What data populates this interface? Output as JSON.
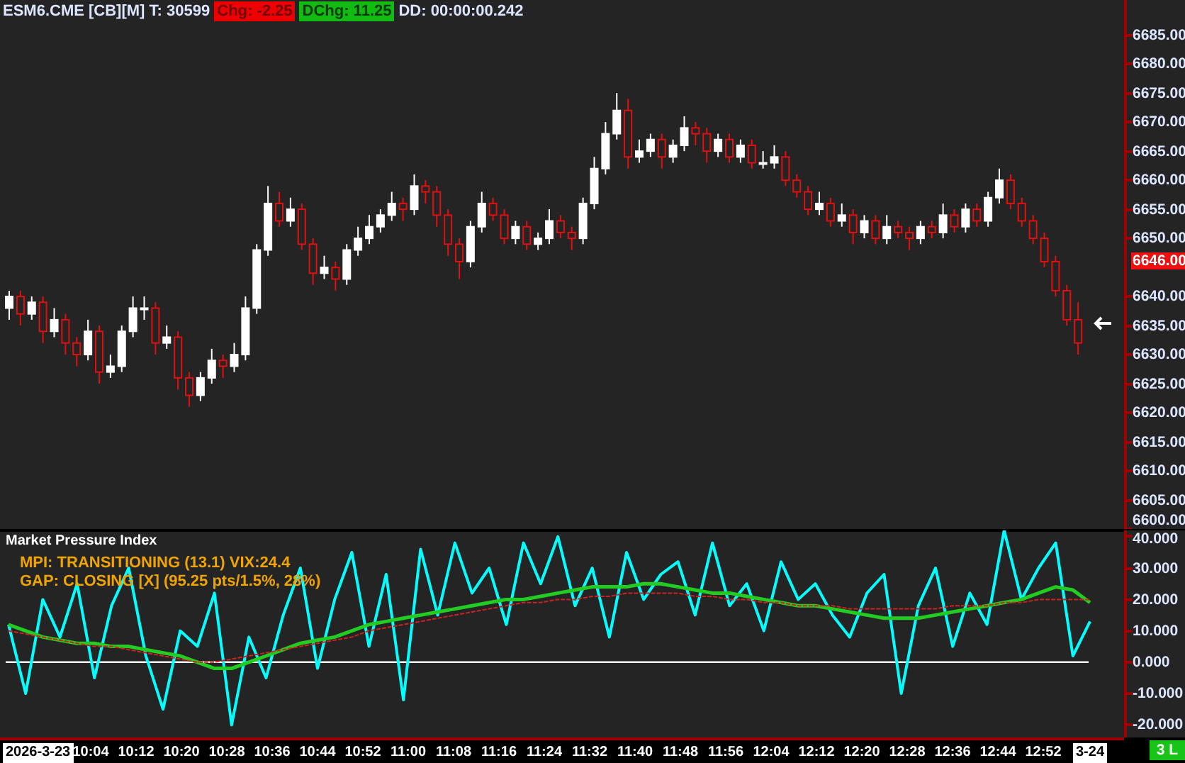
{
  "header": {
    "symbol": "ESM6.CME [CB][M] T: 30599",
    "change": "Chg: -2.25",
    "day_change": "DChg: 11.25",
    "countdown": "DD: 00:00:00.242"
  },
  "price_chart": {
    "last_price": "6646.00",
    "chart_data": {
      "type": "candlestick",
      "ylim": [
        6600,
        6691
      ],
      "yticks": [
        {
          "value": 6685,
          "label": "6685.00"
        },
        {
          "value": 6680,
          "label": "6680.00"
        },
        {
          "value": 6675,
          "label": "6675.00"
        },
        {
          "value": 6670,
          "label": "6670.00"
        },
        {
          "value": 6665,
          "label": "6665.00"
        },
        {
          "value": 6660,
          "label": "6660.00"
        },
        {
          "value": 6655,
          "label": "6655.00"
        },
        {
          "value": 6650,
          "label": "6650.00"
        },
        {
          "value": 6640,
          "label": "6640.00"
        },
        {
          "value": 6635,
          "label": "6635.00"
        },
        {
          "value": 6630,
          "label": "6630.00"
        },
        {
          "value": 6625,
          "label": "6625.00"
        },
        {
          "value": 6620,
          "label": "6620.00"
        },
        {
          "value": 6615,
          "label": "6615.00"
        },
        {
          "value": 6610,
          "label": "6610.00"
        },
        {
          "value": 6605,
          "label": "6605.00"
        },
        {
          "value": 6600,
          "label": "6600.00"
        }
      ],
      "ohlc": [
        [
          6638,
          6641,
          6636,
          6640
        ],
        [
          6640,
          6641,
          6635,
          6637
        ],
        [
          6637,
          6640,
          6636,
          6639
        ],
        [
          6639,
          6640,
          6632,
          6634
        ],
        [
          6634,
          6638,
          6633,
          6636
        ],
        [
          6636,
          6637,
          6630,
          6632
        ],
        [
          6632,
          6633,
          6628,
          6630
        ],
        [
          6630,
          6636,
          6629,
          6634
        ],
        [
          6634,
          6635,
          6625,
          6627
        ],
        [
          6627,
          6630,
          6626,
          6628
        ],
        [
          6628,
          6635,
          6627,
          6634
        ],
        [
          6634,
          6640,
          6633,
          6638
        ],
        [
          6638,
          6640,
          6636,
          6638
        ],
        [
          6638,
          6639,
          6630,
          6632
        ],
        [
          6632,
          6635,
          6631,
          6633
        ],
        [
          6633,
          6634,
          6624,
          6626
        ],
        [
          6626,
          6627,
          6621,
          6623
        ],
        [
          6623,
          6627,
          6622,
          6626
        ],
        [
          6626,
          6631,
          6625,
          6629
        ],
        [
          6629,
          6630,
          6626,
          6628
        ],
        [
          6628,
          6632,
          6627,
          6630
        ],
        [
          6630,
          6640,
          6629,
          6638
        ],
        [
          6638,
          6649,
          6637,
          6648
        ],
        [
          6648,
          6659,
          6647,
          6656
        ],
        [
          6656,
          6658,
          6652,
          6653
        ],
        [
          6653,
          6657,
          6652,
          6655
        ],
        [
          6655,
          6656,
          6648,
          6649
        ],
        [
          6649,
          6650,
          6642,
          6644
        ],
        [
          6644,
          6647,
          6643,
          6645
        ],
        [
          6645,
          6646,
          6641,
          6643
        ],
        [
          6643,
          6649,
          6642,
          6648
        ],
        [
          6648,
          6652,
          6647,
          6650
        ],
        [
          6650,
          6654,
          6649,
          6652
        ],
        [
          6652,
          6655,
          6651,
          6654
        ],
        [
          6654,
          6658,
          6653,
          6656
        ],
        [
          6656,
          6657,
          6653,
          6655
        ],
        [
          6655,
          6661,
          6654,
          6659
        ],
        [
          6659,
          6660,
          6656,
          6658
        ],
        [
          6658,
          6659,
          6652,
          6654
        ],
        [
          6654,
          6655,
          6647,
          6649
        ],
        [
          6649,
          6650,
          6643,
          6646
        ],
        [
          6646,
          6653,
          6645,
          6652
        ],
        [
          6652,
          6658,
          6651,
          6656
        ],
        [
          6656,
          6657,
          6653,
          6654
        ],
        [
          6654,
          6655,
          6649,
          6650
        ],
        [
          6650,
          6653,
          6649,
          6652
        ],
        [
          6652,
          6653,
          6648,
          6649
        ],
        [
          6649,
          6651,
          6648,
          6650
        ],
        [
          6650,
          6655,
          6649,
          6653
        ],
        [
          6653,
          6654,
          6650,
          6651
        ],
        [
          6651,
          6652,
          6648,
          6650
        ],
        [
          6650,
          6657,
          6649,
          6656
        ],
        [
          6656,
          6664,
          6655,
          6662
        ],
        [
          6662,
          6670,
          6661,
          6668
        ],
        [
          6668,
          6675,
          6667,
          6672
        ],
        [
          6672,
          6674,
          6662,
          6664
        ],
        [
          6664,
          6667,
          6663,
          6665
        ],
        [
          6665,
          6668,
          6664,
          6667
        ],
        [
          6667,
          6668,
          6662,
          6664
        ],
        [
          6664,
          6667,
          6663,
          6666
        ],
        [
          6666,
          6671,
          6665,
          6669
        ],
        [
          6669,
          6670,
          6666,
          6668
        ],
        [
          6668,
          6669,
          6663,
          6665
        ],
        [
          6665,
          6668,
          6664,
          6667
        ],
        [
          6667,
          6668,
          6663,
          6664
        ],
        [
          6664,
          6667,
          6663,
          6666
        ],
        [
          6666,
          6667,
          6662,
          6663
        ],
        [
          6663,
          6665,
          6662,
          6663
        ],
        [
          6663,
          6666,
          6662,
          6664
        ],
        [
          6664,
          6665,
          6659,
          6660
        ],
        [
          6660,
          6661,
          6657,
          6658
        ],
        [
          6658,
          6659,
          6654,
          6655
        ],
        [
          6655,
          6658,
          6654,
          6656
        ],
        [
          6656,
          6657,
          6652,
          6653
        ],
        [
          6653,
          6656,
          6652,
          6654
        ],
        [
          6654,
          6655,
          6649,
          6651
        ],
        [
          6651,
          6654,
          6650,
          6653
        ],
        [
          6653,
          6654,
          6649,
          6650
        ],
        [
          6650,
          6654,
          6649,
          6652
        ],
        [
          6652,
          6653,
          6650,
          6651
        ],
        [
          6651,
          6652,
          6648,
          6650
        ],
        [
          6650,
          6653,
          6649,
          6652
        ],
        [
          6652,
          6653,
          6650,
          6651
        ],
        [
          6651,
          6656,
          6650,
          6654
        ],
        [
          6654,
          6655,
          6651,
          6652
        ],
        [
          6652,
          6656,
          6651,
          6655
        ],
        [
          6655,
          6656,
          6652,
          6653
        ],
        [
          6653,
          6658,
          6652,
          6657
        ],
        [
          6657,
          6662,
          6656,
          6660
        ],
        [
          6660,
          6661,
          6655,
          6656
        ],
        [
          6656,
          6657,
          6652,
          6653
        ],
        [
          6653,
          6654,
          6649,
          6650
        ],
        [
          6650,
          6651,
          6645,
          6646
        ],
        [
          6646,
          6647,
          6640,
          6641
        ],
        [
          6641,
          6642,
          6635,
          6636
        ],
        [
          6636,
          6639,
          6630,
          6632
        ]
      ]
    }
  },
  "indicator": {
    "status_lines": [
      "MPI: TRANSITIONING (13.1) VIX:24.4",
      "GAP: CLOSING [X] (95.25 pts/1.5%, 28%)"
    ],
    "chart_data": {
      "type": "line",
      "title": "Market Pressure Index",
      "ylim": [
        -24,
        42
      ],
      "yticks": [
        {
          "value": 40,
          "label": "40.000"
        },
        {
          "value": 30,
          "label": "30.000"
        },
        {
          "value": 20,
          "label": "20.000"
        },
        {
          "value": 10,
          "label": "10.000"
        },
        {
          "value": 0,
          "label": "0.000"
        },
        {
          "value": -10,
          "label": "-10.000"
        },
        {
          "value": -20,
          "label": "-20.000"
        }
      ],
      "series": [
        {
          "color": "#00ffff",
          "line_style": "solid",
          "values": [
            12,
            -10,
            20,
            8,
            25,
            -5,
            18,
            30,
            2,
            -15,
            10,
            5,
            22,
            -20,
            8,
            -5,
            15,
            30,
            -2,
            20,
            35,
            5,
            28,
            -12,
            36,
            15,
            38,
            22,
            30,
            12,
            38,
            25,
            40,
            18,
            30,
            8,
            35,
            20,
            28,
            32,
            15,
            38,
            18,
            25,
            10,
            32,
            20,
            25,
            15,
            8,
            22,
            28,
            -10,
            18,
            30,
            5,
            22,
            12,
            42,
            20,
            30,
            38,
            2,
            13
          ]
        },
        {
          "color": "#22cc22",
          "line_style": "solid",
          "values": [
            12,
            10,
            8,
            7,
            6,
            6,
            5,
            5,
            4,
            3,
            2,
            0,
            -2,
            -2,
            0,
            2,
            4,
            6,
            7,
            8,
            10,
            12,
            13,
            14,
            15,
            16,
            17,
            18,
            19,
            20,
            20,
            21,
            22,
            23,
            24,
            24,
            24,
            25,
            25,
            24,
            23,
            22,
            22,
            21,
            20,
            19,
            18,
            18,
            17,
            16,
            15,
            14,
            14,
            14,
            15,
            16,
            17,
            18,
            19,
            20,
            22,
            24,
            23,
            19
          ]
        },
        {
          "color": "#cc2222",
          "line_style": "dashed",
          "values": [
            10,
            9,
            8,
            7,
            6,
            5,
            5,
            4,
            3,
            2,
            1,
            0,
            0,
            1,
            2,
            3,
            4,
            5,
            6,
            7,
            8,
            10,
            11,
            12,
            13,
            14,
            15,
            16,
            17,
            18,
            19,
            19,
            20,
            20,
            21,
            21,
            22,
            22,
            22,
            22,
            21,
            21,
            20,
            20,
            19,
            19,
            18,
            18,
            18,
            17,
            17,
            17,
            17,
            17,
            17,
            18,
            18,
            18,
            19,
            19,
            20,
            20,
            20,
            20
          ]
        }
      ]
    }
  },
  "time_axis": {
    "start_date": "2026-3-23",
    "labels": [
      "10:04",
      "10:12",
      "10:20",
      "10:28",
      "10:36",
      "10:44",
      "10:52",
      "11:00",
      "11:08",
      "11:16",
      "11:24",
      "11:32",
      "11:40",
      "11:48",
      "11:56",
      "12:04",
      "12:12",
      "12:20",
      "12:28",
      "12:36",
      "12:44",
      "12:52"
    ],
    "end_date": "3-24",
    "status": "3 L"
  }
}
